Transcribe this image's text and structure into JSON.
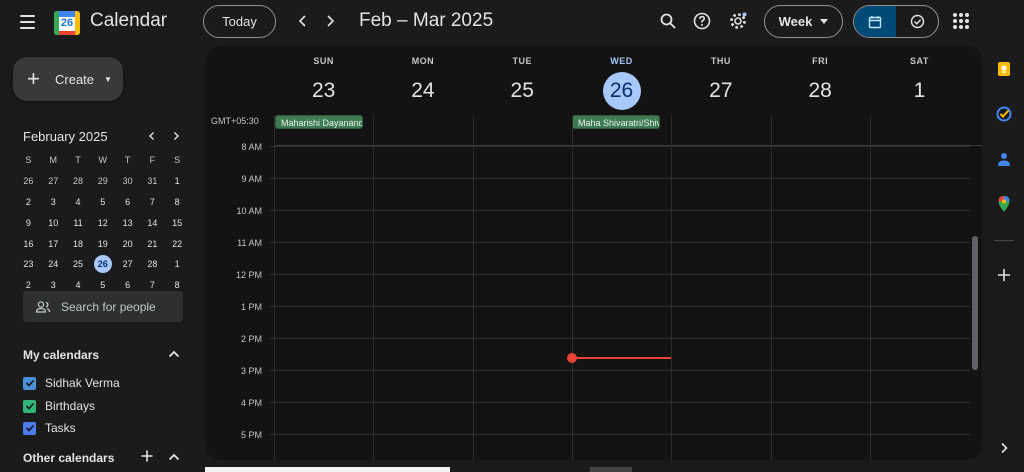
{
  "header": {
    "app_title": "Calendar",
    "logo_day": "26",
    "today_label": "Today",
    "date_range": "Feb – Mar 2025",
    "view_label": "Week"
  },
  "sidebar": {
    "create_label": "Create",
    "mini_month": "February 2025",
    "weekday_headers": [
      "S",
      "M",
      "T",
      "W",
      "T",
      "F",
      "S"
    ],
    "weeks": [
      [
        "26",
        "27",
        "28",
        "29",
        "30",
        "31",
        "1"
      ],
      [
        "2",
        "3",
        "4",
        "5",
        "6",
        "7",
        "8"
      ],
      [
        "9",
        "10",
        "11",
        "12",
        "13",
        "14",
        "15"
      ],
      [
        "16",
        "17",
        "18",
        "19",
        "20",
        "21",
        "22"
      ],
      [
        "23",
        "24",
        "25",
        "26",
        "27",
        "28",
        "1"
      ],
      [
        "2",
        "3",
        "4",
        "5",
        "6",
        "7",
        "8"
      ]
    ],
    "search_people_placeholder": "Search for people",
    "my_calendars_title": "My calendars",
    "my_calendars": [
      {
        "name": "Sidhak Verma",
        "color": "#4a90d9"
      },
      {
        "name": "Birthdays",
        "color": "#33b679"
      },
      {
        "name": "Tasks",
        "color": "#4c7cf0"
      }
    ],
    "other_calendars_title": "Other calendars"
  },
  "week": {
    "timezone": "GMT+05:30",
    "days": [
      {
        "name": "SUN",
        "num": "23"
      },
      {
        "name": "MON",
        "num": "24"
      },
      {
        "name": "TUE",
        "num": "25"
      },
      {
        "name": "WED",
        "num": "26",
        "today": true
      },
      {
        "name": "THU",
        "num": "27"
      },
      {
        "name": "FRI",
        "num": "28"
      },
      {
        "name": "SAT",
        "num": "1"
      }
    ],
    "all_day_events": [
      {
        "title": "Maharishi Dayanand Saraswati Jayanti",
        "day": "SUN"
      },
      {
        "title": "Maha Shivaratri/Shivaratri",
        "day": "WED"
      }
    ],
    "hours": [
      "8 AM",
      "9 AM",
      "10 AM",
      "11 AM",
      "12 PM",
      "1 PM",
      "2 PM",
      "3 PM",
      "4 PM",
      "5 PM"
    ]
  },
  "colors": {
    "accent": "#a8c7fa",
    "today_text": "#062e6f",
    "now_indicator": "#ea4335",
    "event_chip": "#3f7a52"
  },
  "icons": {
    "menu": "menu-icon",
    "search": "search-icon",
    "help": "help-icon",
    "settings": "gear-icon",
    "apps": "apps-grid-icon",
    "keep": "keep-icon",
    "tasks": "tasks-icon",
    "contacts": "contacts-icon",
    "maps": "maps-icon"
  }
}
